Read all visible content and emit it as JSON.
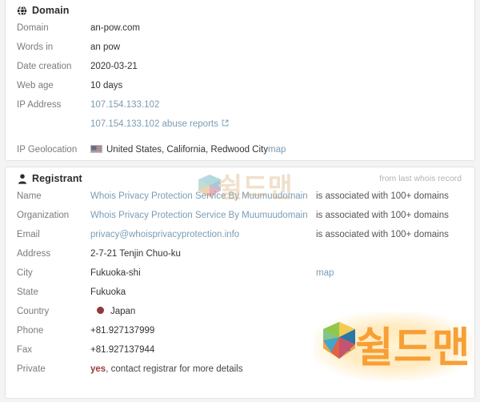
{
  "domain_card": {
    "icon": "globe-icon",
    "title": "Domain",
    "rows": [
      {
        "label": "Domain",
        "value": "an-pow.com",
        "type": "text"
      },
      {
        "label": "Words in",
        "value": "an pow",
        "type": "text"
      },
      {
        "label": "Date creation",
        "value": "2020-03-21",
        "type": "text"
      },
      {
        "label": "Web age",
        "value": "10 days",
        "type": "text"
      },
      {
        "label": "IP Address",
        "value": "107.154.133.102",
        "type": "link"
      },
      {
        "label": "",
        "value": "107.154.133.102 abuse reports",
        "type": "link-external",
        "icon": "external-link-icon"
      },
      {
        "label": "IP Geolocation",
        "value": "United States, California, Redwood City",
        "type": "flag",
        "flag": "us-flag-icon",
        "extra": "map"
      }
    ]
  },
  "registrant_card": {
    "icon": "user-icon",
    "title": "Registrant",
    "note": "from last whois record",
    "rows": [
      {
        "label": "Name",
        "value": "Whois Privacy Protection Service By Muumuudomain",
        "type": "link",
        "note": "is associated with 100+ domains"
      },
      {
        "label": "Organization",
        "value": "Whois Privacy Protection Service By Muumuudomain",
        "type": "link",
        "note": "is associated with 100+ domains"
      },
      {
        "label": "Email",
        "value": "privacy@whoisprivacyprotection.info",
        "type": "link",
        "note": "is associated with 100+ domains"
      },
      {
        "label": "Address",
        "value": "2-7-21 Tenjin Chuo-ku",
        "type": "text",
        "note": ""
      },
      {
        "label": "City",
        "value": "Fukuoka-shi",
        "type": "text",
        "note": "map",
        "note_link": true
      },
      {
        "label": "State",
        "value": "Fukuoka",
        "type": "text",
        "note": ""
      },
      {
        "label": "Country",
        "value": "Japan",
        "type": "flag-jp",
        "flag": "jp-flag-icon",
        "note": ""
      },
      {
        "label": "Phone",
        "value": "+81.927137999",
        "type": "text",
        "note": ""
      },
      {
        "label": "Fax",
        "value": "+81.927137944",
        "type": "text",
        "note": ""
      },
      {
        "label": "Private",
        "value": "yes",
        "value_rest": ", contact registrar for more details",
        "type": "private",
        "note": ""
      }
    ]
  },
  "watermarks": {
    "top": {
      "text": "쉴드맨",
      "logo": "shieldman-logo-icon"
    },
    "bottom": {
      "text": "쉴드맨",
      "logo": "shieldman-logo-icon"
    }
  },
  "colors": {
    "link": "#7a9cb5",
    "label": "#7b7b7b",
    "accent_red": "#a03a3a",
    "watermark_orange": "#f89a2a"
  }
}
